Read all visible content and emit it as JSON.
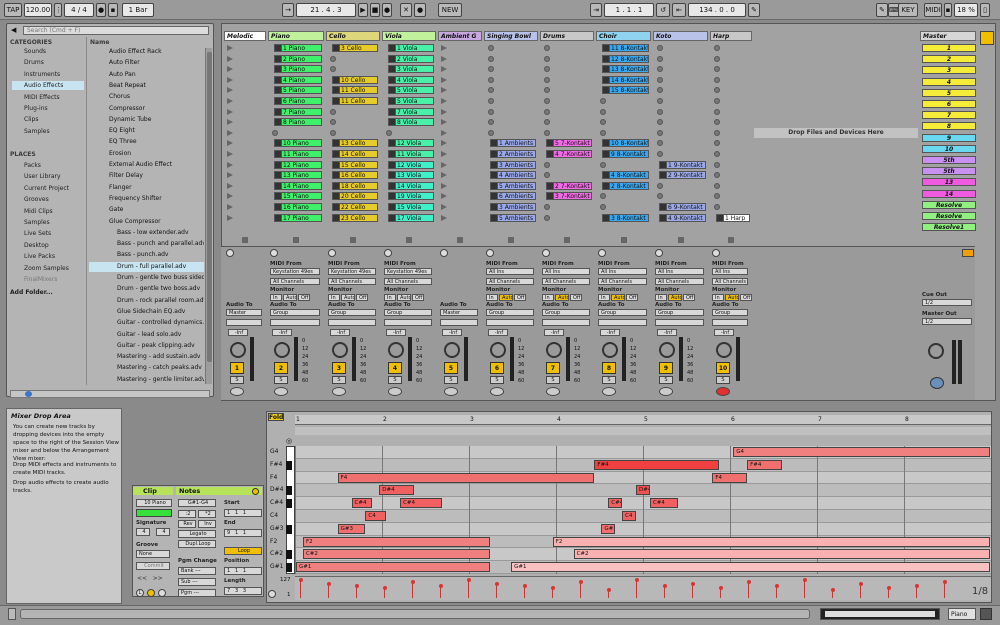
{
  "transport": {
    "tap": "TAP",
    "tempo": "120.00",
    "signature": "4 / 4",
    "quant": "1 Bar",
    "position": "21 . 4 . 3",
    "new": "NEW",
    "loop_start": "1 . 1 . 1",
    "loop_len": "134 . 0 . 0",
    "key": "KEY",
    "midi": "MIDI",
    "cpu": "18 %"
  },
  "browser": {
    "search_placeholder": "Search (Cmd + F)",
    "categories_label": "CATEGORIES",
    "categories": [
      "Sounds",
      "Drums",
      "Instruments",
      "Audio Effects",
      "MIDI Effects",
      "Plug-ins",
      "Clips",
      "Samples"
    ],
    "places_label": "PLACES",
    "places": [
      "Packs",
      "User Library",
      "Current Project",
      "Grooves",
      "Midi Clips",
      "Samples",
      "Live Sets",
      "Desktop",
      "Live Packs",
      "Zoom Samples",
      "FinalMixers"
    ],
    "add_folder": "Add Folder...",
    "name_header": "Name",
    "items": [
      "Audio Effect Rack",
      "Auto Filter",
      "Auto Pan",
      "Beat Repeat",
      "Chorus",
      "Compressor",
      "Dynamic Tube",
      "EQ Eight",
      "EQ Three",
      "Erosion",
      "External Audio Effect",
      "Filter Delay",
      "Flanger",
      "Frequency Shifter",
      "Gate",
      "Glue Compressor",
      "Bass - low extender.adv",
      "Bass - punch and parallel.adv",
      "Bass - punch.adv",
      "Drum - full parallel.adv",
      "Drum - gentle two buss sidecha",
      "Drum - gentle two boss.adv",
      "Drum - rock parallel room.adv",
      "Glue Sidechain EQ.adv",
      "Guitar - controlled dynamics.ad",
      "Guitar - lead solo.adv",
      "Guitar - peak clipping.adv",
      "Mastering - add sustain.adv",
      "Mastering - catch peaks.adv",
      "Mastering - gentle limiter.adv"
    ]
  },
  "info": {
    "title": "Mixer Drop Area",
    "body": "You can create new tracks by dropping devices into the empty space to the right of the Session View mixer and below the Arrangement View mixer:",
    "bullet1": "Drop MIDI effects and instruments to create MIDI tracks.",
    "bullet2": "Drop audio effects to create audio tracks."
  },
  "tracks": [
    {
      "name": "Melodic",
      "color": "#ffffff",
      "clips": []
    },
    {
      "name": "Piano",
      "color": "#bff29a",
      "clips": [
        "1 Piano",
        "2 Piano",
        "3 Piano",
        "4 Piano",
        "5 Piano",
        "6 Piano",
        "7 Piano",
        "8 Piano",
        "",
        "10 Piano",
        "11 Piano",
        "12 Piano",
        "13 Piano",
        "14 Piano",
        "15 Piano",
        "16 Piano",
        "17 Piano",
        "18 Piano",
        "20 Piano",
        "21 Piano"
      ]
    },
    {
      "name": "Cello",
      "color": "#ded67a",
      "clips": [
        "3 Cello",
        "",
        "",
        "10 Cello",
        "11 Cello",
        "11 Cello",
        "",
        "",
        "",
        "13 Cello",
        "14 Cello",
        "15 Cello",
        "16 Cello",
        "18 Cello",
        "20 Cello",
        "22 Cello",
        "23 Cello",
        "24 Cello",
        "25 Cello"
      ]
    },
    {
      "name": "Viola",
      "color": "#bff29a",
      "clips": [
        "1 Viola",
        "2 Viola",
        "3 Viola",
        "4 Viola",
        "5 Viola",
        "5 Viola",
        "7 Viola",
        "8 Viola",
        "",
        "12 Viola",
        "11 Viola",
        "12 Viola",
        "13 Viola",
        "14 Viola",
        "19 Viola",
        "15 Viola",
        "17 Viola",
        "18 Viola",
        "19 Viola"
      ]
    },
    {
      "name": "Ambient G",
      "color": "#c8a8e0",
      "clips": []
    },
    {
      "name": "Singing Bowl",
      "color": "#b9c2e8",
      "clips": [
        "",
        "",
        "",
        "",
        "",
        "",
        "",
        "",
        "",
        "1 Ambients",
        "2 Ambients",
        "3 Ambients",
        "4 Ambients",
        "5 Ambients",
        "6 Ambients",
        "3 Ambients",
        "5 Ambients",
        "4 Ambients"
      ]
    },
    {
      "name": "Drums",
      "color": "#c8c8c8",
      "clips": [
        "",
        "",
        "",
        "",
        "",
        "",
        "",
        "",
        "",
        "5 7-Kontakt 5",
        "4 7-Kontakt 5",
        "",
        "",
        "2 7-Kontakt 5",
        "3 7-Kontakt 5"
      ]
    },
    {
      "name": "Choir",
      "color": "#8fd3f0",
      "clips": [
        "11 8-Kontakt 5",
        "12 8-Kontakt 5",
        "13 8-Kontakt 5",
        "14 8-Kontakt 5",
        "15 8-Kontakt 5",
        "",
        "",
        "",
        "",
        "10 8-Kontakt 5",
        "9 8-Kontakt 5",
        "",
        "4 8-Kontakt 5",
        "2 8-Kontakt 5",
        "",
        "",
        "3 8-Kontakt 5",
        "2 8-Kontakt 5",
        "3 8-Kontakt 5"
      ]
    },
    {
      "name": "Koto",
      "color": "#b9c2e8",
      "clips": [
        "",
        "",
        "",
        "",
        "",
        "",
        "",
        "",
        "",
        "",
        "",
        "1 9-Kontakt 5",
        "2 9-Kontakt 5",
        "",
        "",
        "6 9-Kontakt 5",
        "4 9-Kontakt 5",
        "3 9-Kontakt 5"
      ]
    },
    {
      "name": "Harp",
      "color": "#c8c8c8",
      "clips": [
        "",
        "",
        "",
        "",
        "",
        "",
        "",
        "",
        "",
        "",
        "",
        "",
        "",
        "",
        "",
        "",
        "1 Harp",
        "1 Harp"
      ]
    }
  ],
  "drop_hint": "Drop Files and Devices Here",
  "master": {
    "name": "Master",
    "scenes": [
      "1",
      "2",
      "3",
      "4",
      "5",
      "6",
      "7",
      "8",
      "9",
      "10",
      "5th",
      "5th",
      "13",
      "14",
      "Resolve",
      "Resolve",
      "Resolve1"
    ],
    "cue_label": "Cue Out",
    "cue_value": "1/2",
    "master_out_label": "Master Out",
    "master_out_value": "1/2"
  },
  "mixer": {
    "midi_from": "MIDI From",
    "input": "Keystation 49es",
    "channels": "All Channels",
    "all_ins": "All Ins",
    "monitor": "Monitor",
    "in": "In",
    "auto": "Auto",
    "off": "Off",
    "audio_to": "Audio To",
    "master": "Master",
    "group": "Group",
    "inf": "-Inf",
    "track_nums": [
      "1",
      "2",
      "3",
      "4",
      "5",
      "6",
      "7",
      "8",
      "9",
      "10"
    ],
    "db": [
      "0",
      "12",
      "24",
      "36",
      "48",
      "60"
    ]
  },
  "clip_panel": {
    "clip_label": "Clip",
    "notes_label": "Notes",
    "clip_name": "10 Piano",
    "range": "G#1-G4",
    "signature_label": "Signature",
    "sig_num": "4",
    "sig_den": "4",
    "groove_label": "Groove",
    "groove": "None",
    "commit": "Commit",
    "start_label": "Start",
    "end_label": "End",
    "loop_label": "Loop",
    "position_label": "Position",
    "length_label": "Length",
    "rev": "Rev",
    "inv": "Inv",
    "legato": "Legato",
    "dupl": "Dupl.Loop",
    "pgm_label": "Pgm Change",
    "bank": "Bank ---",
    "sub": "Sub ---",
    "pgm": "Pgm ---",
    "fold": "Fold"
  },
  "piano_roll": {
    "bars": [
      "1",
      "2",
      "3",
      "4",
      "5",
      "6",
      "7",
      "8"
    ],
    "keys": [
      "G4",
      "F#4",
      "F4",
      "D#4",
      "C#4",
      "C4",
      "G#3",
      "F2",
      "C#2",
      "G#1"
    ],
    "vel_max": "127",
    "vel_min": "1",
    "page": "1/8",
    "notes": [
      {
        "label": "G4",
        "row": 0,
        "x": 0.63,
        "w": 0.37,
        "c": "#f08080"
      },
      {
        "label": "F#4",
        "row": 1,
        "x": 0.43,
        "w": 0.18,
        "c": "#f04040"
      },
      {
        "label": "F#4",
        "row": 1,
        "x": 0.65,
        "w": 0.05,
        "c": "#f07070"
      },
      {
        "label": "F4",
        "row": 2,
        "x": 0.06,
        "w": 0.37,
        "c": "#f07070"
      },
      {
        "label": "F4",
        "row": 2,
        "x": 0.6,
        "w": 0.05,
        "c": "#f07070"
      },
      {
        "label": "D#4",
        "row": 3,
        "x": 0.12,
        "w": 0.05,
        "c": "#f06060"
      },
      {
        "label": "D#4",
        "row": 3,
        "x": 0.49,
        "w": 0.02,
        "c": "#f05050"
      },
      {
        "label": "C#4",
        "row": 4,
        "x": 0.08,
        "w": 0.03,
        "c": "#f06060"
      },
      {
        "label": "C#4",
        "row": 4,
        "x": 0.15,
        "w": 0.06,
        "c": "#f06060"
      },
      {
        "label": "C#4",
        "row": 4,
        "x": 0.45,
        "w": 0.02,
        "c": "#f06060"
      },
      {
        "label": "C#4",
        "row": 4,
        "x": 0.51,
        "w": 0.04,
        "c": "#f06060"
      },
      {
        "label": "C4",
        "row": 5,
        "x": 0.1,
        "w": 0.03,
        "c": "#f06060"
      },
      {
        "label": "C4",
        "row": 5,
        "x": 0.47,
        "w": 0.02,
        "c": "#f06060"
      },
      {
        "label": "G#3",
        "row": 6,
        "x": 0.06,
        "w": 0.04,
        "c": "#f07070"
      },
      {
        "label": "G#3",
        "row": 6,
        "x": 0.44,
        "w": 0.02,
        "c": "#f07070"
      },
      {
        "label": "F2",
        "row": 7,
        "x": 0.01,
        "w": 0.27,
        "c": "#f08080"
      },
      {
        "label": "F2",
        "row": 7,
        "x": 0.37,
        "w": 0.63,
        "c": "#f8b0b0"
      },
      {
        "label": "C#2",
        "row": 8,
        "x": 0.01,
        "w": 0.27,
        "c": "#f08080"
      },
      {
        "label": "C#2",
        "row": 8,
        "x": 0.4,
        "w": 0.6,
        "c": "#f8b0b0"
      },
      {
        "label": "G#1",
        "row": 9,
        "x": 0.0,
        "w": 0.28,
        "c": "#f08080"
      },
      {
        "label": "G#1",
        "row": 9,
        "x": 0.31,
        "w": 0.69,
        "c": "#f8c0c0"
      }
    ],
    "velocities": [
      0.9,
      0.7,
      0.6,
      0.5,
      0.8,
      0.6,
      0.9,
      0.7,
      0.6,
      0.5,
      0.8,
      0.4,
      0.9,
      0.6,
      0.7,
      0.5,
      0.8,
      0.6,
      0.9,
      0.4,
      0.7,
      0.5,
      0.6,
      0.8
    ]
  },
  "status": {
    "track": "Piano"
  }
}
